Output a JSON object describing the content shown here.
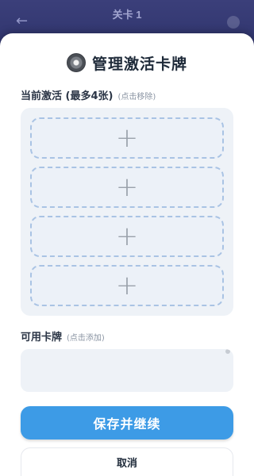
{
  "background": {
    "back_icon": "arrow-left-icon",
    "title": "关卡 1",
    "gear_icon": "gear-icon"
  },
  "modal": {
    "title_icon": "gear-icon",
    "title": "管理激活卡牌",
    "active_section": {
      "label": "当前激活 (最多4张)",
      "hint": "(点击移除)",
      "slots": [
        {
          "symbol": "+"
        },
        {
          "symbol": "+"
        },
        {
          "symbol": "+"
        },
        {
          "symbol": "+"
        }
      ]
    },
    "available_section": {
      "label": "可用卡牌",
      "hint": "(点击添加)"
    },
    "save_label": "保存并继续",
    "cancel_label": "取消"
  },
  "colors": {
    "accent": "#3d9be6",
    "overlay": "#2a2f68",
    "panel": "#eef2f7",
    "slot_border": "#a9c3e4"
  }
}
